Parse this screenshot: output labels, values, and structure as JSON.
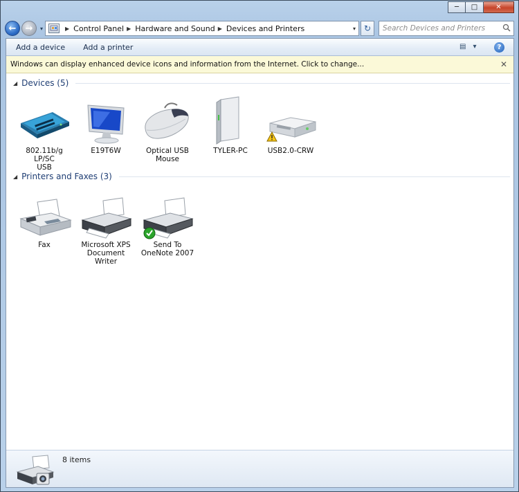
{
  "window": {
    "caption": {
      "minimize": "─",
      "maximize": "□",
      "close": "✕"
    }
  },
  "nav": {
    "back": "←",
    "forward": "→",
    "dropdown": "▾",
    "breadcrumb": [
      "Control Panel",
      "Hardware and Sound",
      "Devices and Printers"
    ],
    "breadcrumb_separator": "▶",
    "refresh": "↻",
    "search_placeholder": "Search Devices and Printers"
  },
  "toolbar": {
    "add_device": "Add a device",
    "add_printer": "Add a printer",
    "view_icon": "▤",
    "view_dropdown": "▾",
    "help": "?"
  },
  "infobar": {
    "text": "Windows can display enhanced device icons and information from the Internet. Click to change...",
    "close": "✕"
  },
  "groups": {
    "devices": {
      "arrow": "◢",
      "title": "Devices (5)",
      "items": [
        {
          "label_line1": "802.11b/g LP/SC",
          "label_line2": "USB",
          "icon": "wireless-adapter-icon"
        },
        {
          "label_line1": "E19T6W",
          "label_line2": "",
          "icon": "monitor-icon"
        },
        {
          "label_line1": "Optical USB",
          "label_line2": "Mouse",
          "icon": "mouse-icon"
        },
        {
          "label_line1": "TYLER-PC",
          "label_line2": "",
          "icon": "computer-tower-icon"
        },
        {
          "label_line1": "USB2.0-CRW",
          "label_line2": "",
          "icon": "card-reader-icon",
          "warning": true
        }
      ]
    },
    "printers": {
      "arrow": "◢",
      "title": "Printers and Faxes (3)",
      "items": [
        {
          "label_line1": "Fax",
          "label_line2": "",
          "icon": "fax-icon"
        },
        {
          "label_line1": "Microsoft XPS",
          "label_line2": "Document Writer",
          "icon": "printer-icon"
        },
        {
          "label_line1": "Send To",
          "label_line2": "OneNote 2007",
          "icon": "printer-icon",
          "default": true
        }
      ]
    }
  },
  "status": {
    "count": "8 items",
    "icon": "devices-printers-icon"
  },
  "colors": {
    "group_title": "#1e3d73",
    "infobar_bg": "#fbf9d8",
    "frame_bg": "#b9d1ea"
  }
}
